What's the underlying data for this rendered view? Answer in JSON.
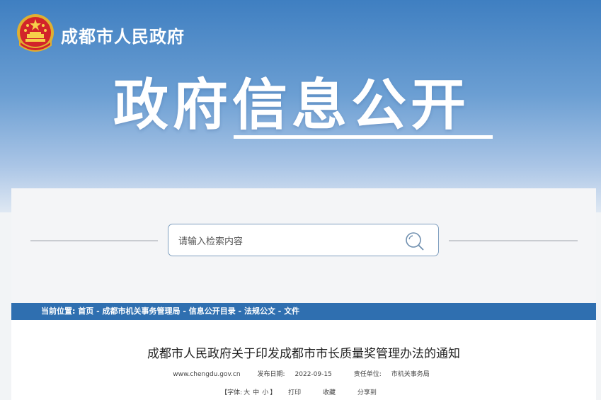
{
  "header": {
    "site_name": "成都市人民政府",
    "banner_title": "政府信息公开"
  },
  "search": {
    "placeholder": "请输入检索内容"
  },
  "breadcrumb": {
    "label": "当前位置:",
    "items": [
      "首页",
      "成都市机关事务管理局",
      "信息公开目录",
      "法规公文",
      "文件"
    ],
    "separator": " - "
  },
  "article": {
    "title": "成都市人民政府关于印发成都市市长质量奖管理办法的通知",
    "source": "www.chengdu.gov.cn",
    "publish_label": "发布日期:",
    "publish_date": "2022-09-15",
    "unit_label": "责任单位:",
    "unit": "市机关事务局"
  },
  "tools": {
    "font_prefix": "【字体:",
    "font_sizes": [
      "大",
      "中",
      "小"
    ],
    "font_suffix": "】",
    "print": "打印",
    "favorite": "收藏",
    "share": "分享到"
  },
  "colors": {
    "banner_top": "#3f7fc1",
    "breadcrumb_bar": "#2f6fb0",
    "search_border": "#7f9fbf"
  },
  "icons": {
    "emblem": "national-emblem-icon",
    "search": "search-icon"
  }
}
